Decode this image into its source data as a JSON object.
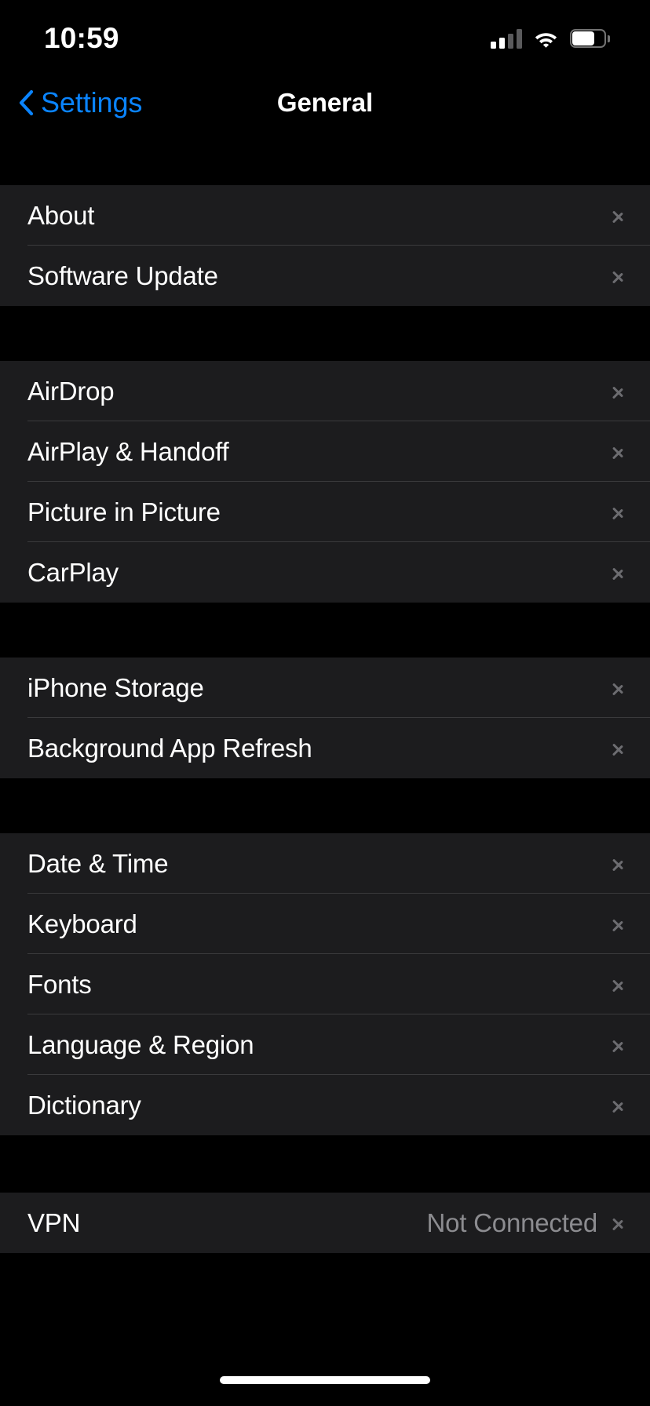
{
  "status_bar": {
    "time": "10:59",
    "cellular_icon": "cellular-signal-icon",
    "cellular_bars_filled": 2,
    "cellular_bars_total": 4,
    "wifi_icon": "wifi-icon",
    "battery_icon": "battery-icon",
    "battery_level_percent": 70
  },
  "nav": {
    "back_icon": "chevron-left-icon",
    "back_label": "Settings",
    "title": "General"
  },
  "colors": {
    "accent": "#0a84ff",
    "page_background": "#000000",
    "row_background": "#1c1c1e",
    "separator": "#3a3a3c",
    "primary_text": "#ffffff",
    "secondary_text": "#8c8c90",
    "chevron": "#6c6c70"
  },
  "sections": [
    {
      "id": "device-info",
      "rows": [
        {
          "label": "About",
          "value": "",
          "chevron_icon": "chevron-right-icon"
        },
        {
          "label": "Software Update",
          "value": "",
          "chevron_icon": "chevron-right-icon"
        }
      ]
    },
    {
      "id": "connectivity",
      "rows": [
        {
          "label": "AirDrop",
          "value": "",
          "chevron_icon": "chevron-right-icon"
        },
        {
          "label": "AirPlay & Handoff",
          "value": "",
          "chevron_icon": "chevron-right-icon"
        },
        {
          "label": "Picture in Picture",
          "value": "",
          "chevron_icon": "chevron-right-icon"
        },
        {
          "label": "CarPlay",
          "value": "",
          "chevron_icon": "chevron-right-icon"
        }
      ]
    },
    {
      "id": "storage",
      "rows": [
        {
          "label": "iPhone Storage",
          "value": "",
          "chevron_icon": "chevron-right-icon"
        },
        {
          "label": "Background App Refresh",
          "value": "",
          "chevron_icon": "chevron-right-icon"
        }
      ]
    },
    {
      "id": "localization",
      "rows": [
        {
          "label": "Date & Time",
          "value": "",
          "chevron_icon": "chevron-right-icon"
        },
        {
          "label": "Keyboard",
          "value": "",
          "chevron_icon": "chevron-right-icon"
        },
        {
          "label": "Fonts",
          "value": "",
          "chevron_icon": "chevron-right-icon"
        },
        {
          "label": "Language & Region",
          "value": "",
          "chevron_icon": "chevron-right-icon"
        },
        {
          "label": "Dictionary",
          "value": "",
          "chevron_icon": "chevron-right-icon"
        }
      ]
    },
    {
      "id": "vpn",
      "rows": [
        {
          "label": "VPN",
          "value": "Not Connected",
          "chevron_icon": "chevron-right-icon"
        }
      ]
    }
  ],
  "home_indicator": "home-indicator-bar"
}
